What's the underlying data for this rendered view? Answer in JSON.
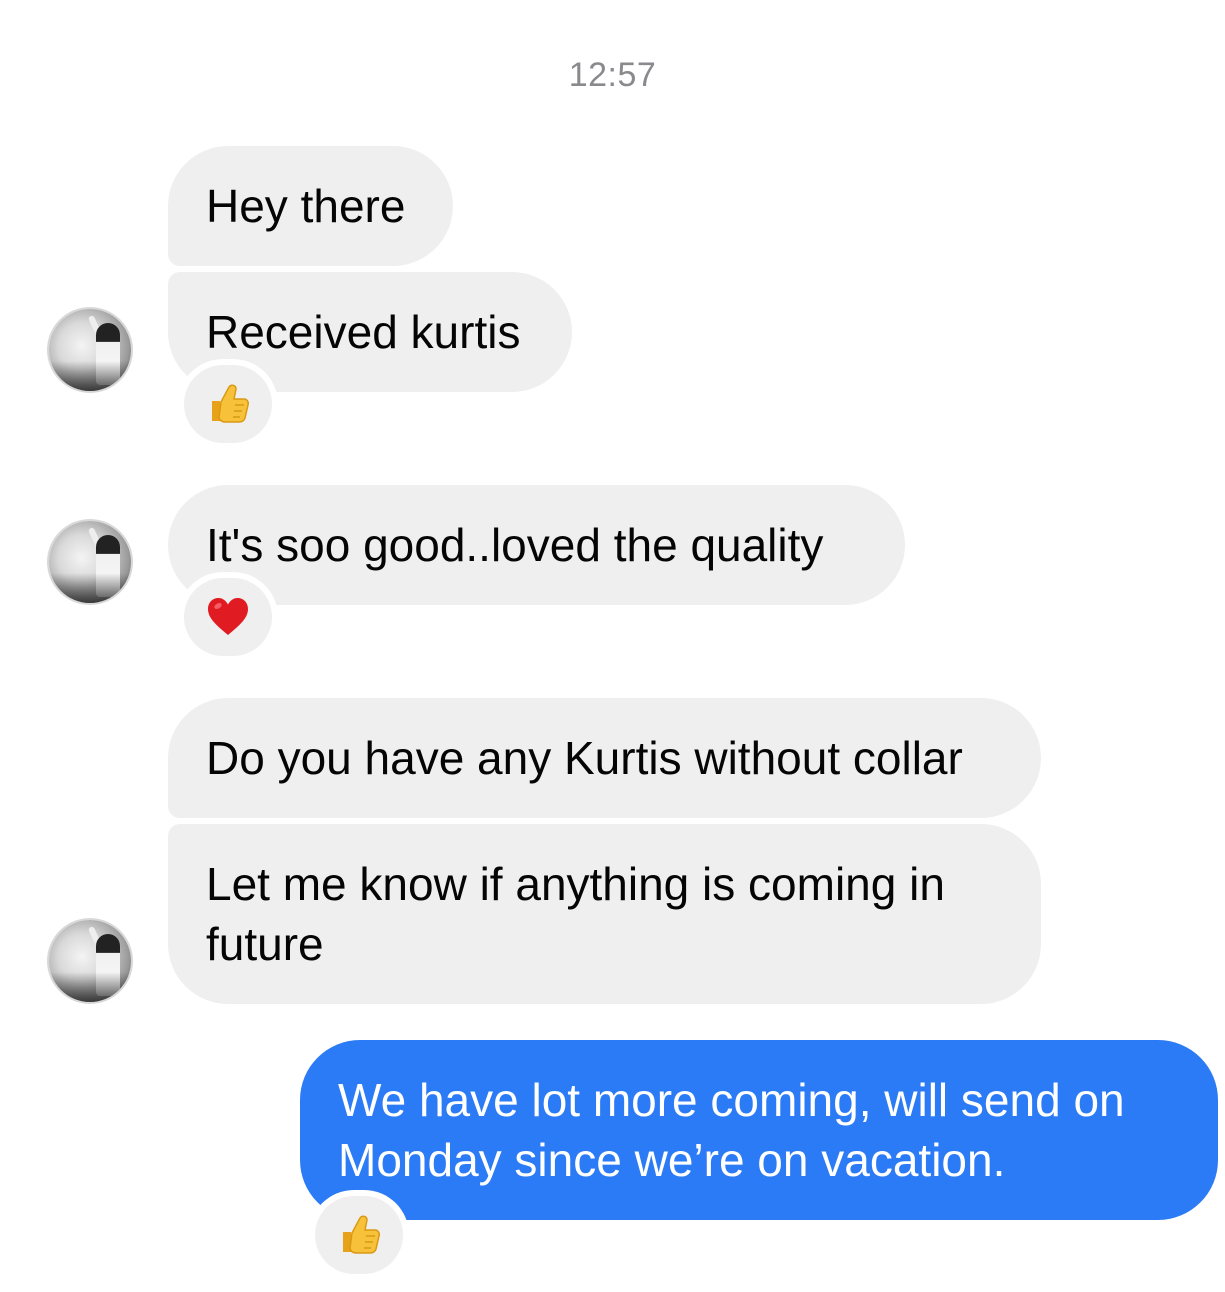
{
  "conversation": {
    "timestamp": "12:57",
    "messages": [
      {
        "from": "contact",
        "text": "Hey there"
      },
      {
        "from": "contact",
        "text": "Received kurtis",
        "reaction": "thumbs-up"
      },
      {
        "from": "contact",
        "text": "It's soo good..loved the quality",
        "reaction": "red-heart"
      },
      {
        "from": "contact",
        "text": "Do you have any Kurtis without collar"
      },
      {
        "from": "contact",
        "text": "Let me know if anything is coming in future"
      },
      {
        "from": "me",
        "text": "We have lot more coming, will send on Monday since we’re on vacation.",
        "reaction": "thumbs-up"
      }
    ]
  },
  "colors": {
    "incoming_bubble": "#efefef",
    "outgoing_bubble": "#2c7bf6",
    "timestamp_text": "#8a8a8e"
  }
}
